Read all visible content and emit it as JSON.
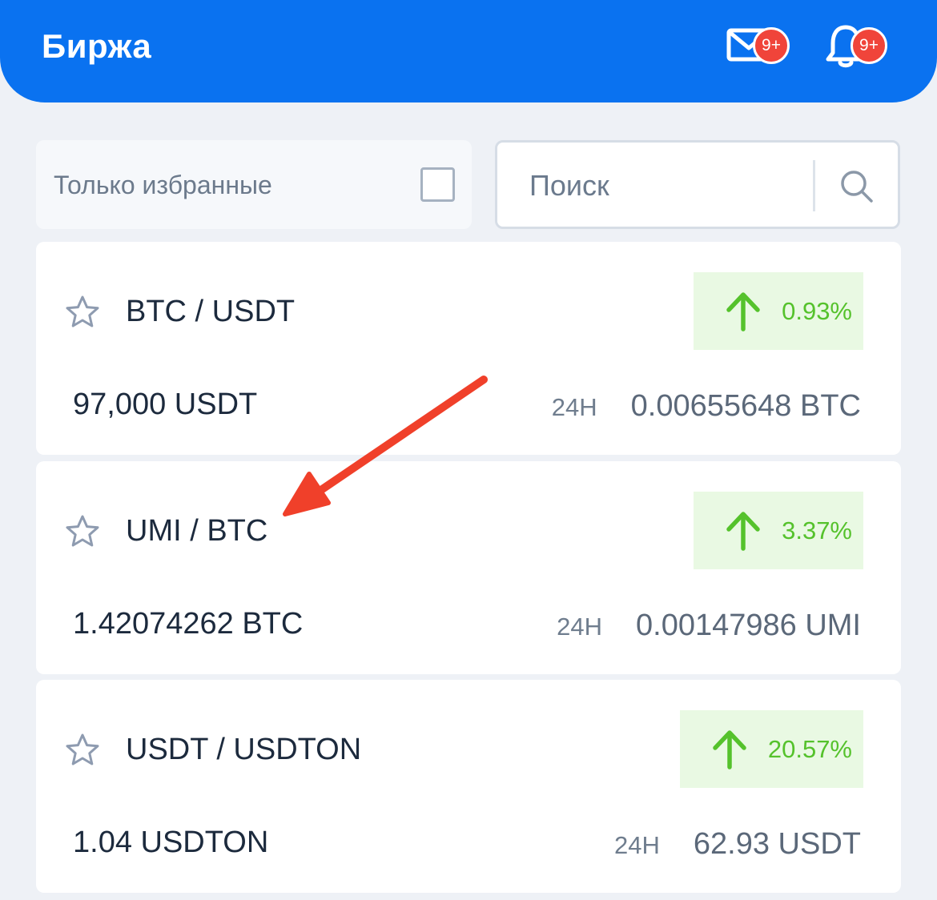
{
  "header": {
    "title": "Биржа",
    "mail_badge": "9+",
    "notifications_badge": "9+",
    "mail_icon": "mail-icon",
    "bell_icon": "bell-icon",
    "accent_color": "#0a72f0",
    "badge_color": "#f0443a"
  },
  "filter": {
    "favorites_label": "Только избранные",
    "favorites_checked": false,
    "search_placeholder": "Поиск",
    "search_value": ""
  },
  "markets": [
    {
      "pair": "BTC / USDT",
      "change": "0.93%",
      "price": "97,000 USDT",
      "period": "24H",
      "volume": "0.00655648 BTC",
      "favorite": false
    },
    {
      "pair": "UMI / BTC",
      "change": "3.37%",
      "price": "1.42074262 BTC",
      "period": "24H",
      "volume": "0.00147986 UMI",
      "favorite": false
    },
    {
      "pair": "USDT / USDTON",
      "change": "20.57%",
      "price": "1.04 USDTON",
      "period": "24H",
      "volume": "62.93 USDT",
      "favorite": false
    }
  ],
  "colors": {
    "positive": "#55c22c",
    "positive_bg": "#e9f9e3",
    "annotation_arrow": "#f0402a"
  }
}
